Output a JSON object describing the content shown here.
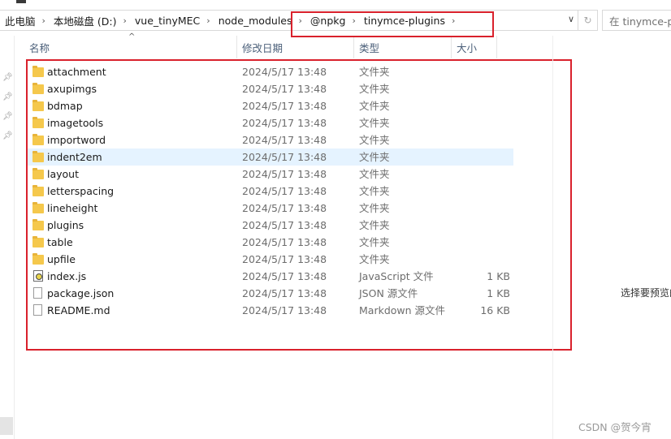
{
  "address_bar": {
    "crumbs": [
      "此电脑",
      "本地磁盘 (D:)",
      "vue_tinyMEC",
      "node_modules",
      "@npkg",
      "tinymce-plugins"
    ],
    "dropdown_icon": "chevron-down-icon",
    "refresh_icon": "refresh-icon"
  },
  "search": {
    "placeholder": "在 tinymce-pl"
  },
  "columns": {
    "name": "名称",
    "date": "修改日期",
    "type": "类型",
    "size": "大小"
  },
  "files": [
    {
      "name": "attachment",
      "date": "2024/5/17 13:48",
      "type": "文件夹",
      "size": "",
      "icon": "folder-icon"
    },
    {
      "name": "axupimgs",
      "date": "2024/5/17 13:48",
      "type": "文件夹",
      "size": "",
      "icon": "folder-icon"
    },
    {
      "name": "bdmap",
      "date": "2024/5/17 13:48",
      "type": "文件夹",
      "size": "",
      "icon": "folder-icon"
    },
    {
      "name": "imagetools",
      "date": "2024/5/17 13:48",
      "type": "文件夹",
      "size": "",
      "icon": "folder-icon"
    },
    {
      "name": "importword",
      "date": "2024/5/17 13:48",
      "type": "文件夹",
      "size": "",
      "icon": "folder-icon"
    },
    {
      "name": "indent2em",
      "date": "2024/5/17 13:48",
      "type": "文件夹",
      "size": "",
      "icon": "folder-icon",
      "selected": true
    },
    {
      "name": "layout",
      "date": "2024/5/17 13:48",
      "type": "文件夹",
      "size": "",
      "icon": "folder-icon"
    },
    {
      "name": "letterspacing",
      "date": "2024/5/17 13:48",
      "type": "文件夹",
      "size": "",
      "icon": "folder-icon"
    },
    {
      "name": "lineheight",
      "date": "2024/5/17 13:48",
      "type": "文件夹",
      "size": "",
      "icon": "folder-icon"
    },
    {
      "name": "plugins",
      "date": "2024/5/17 13:48",
      "type": "文件夹",
      "size": "",
      "icon": "folder-icon"
    },
    {
      "name": "table",
      "date": "2024/5/17 13:48",
      "type": "文件夹",
      "size": "",
      "icon": "folder-icon"
    },
    {
      "name": "upfile",
      "date": "2024/5/17 13:48",
      "type": "文件夹",
      "size": "",
      "icon": "folder-icon"
    },
    {
      "name": "index.js",
      "date": "2024/5/17 13:48",
      "type": "JavaScript 文件",
      "size": "1 KB",
      "icon": "js-file-icon"
    },
    {
      "name": "package.json",
      "date": "2024/5/17 13:48",
      "type": "JSON 源文件",
      "size": "1 KB",
      "icon": "document-icon"
    },
    {
      "name": "README.md",
      "date": "2024/5/17 13:48",
      "type": "Markdown 源文件",
      "size": "16 KB",
      "icon": "document-icon"
    }
  ],
  "preview": {
    "text": "选择要预览的"
  },
  "watermark": "CSDN @贺今宵",
  "colors": {
    "highlight": "#d9212c",
    "selection": "#e5f3ff",
    "folder": "#f5c84c"
  }
}
